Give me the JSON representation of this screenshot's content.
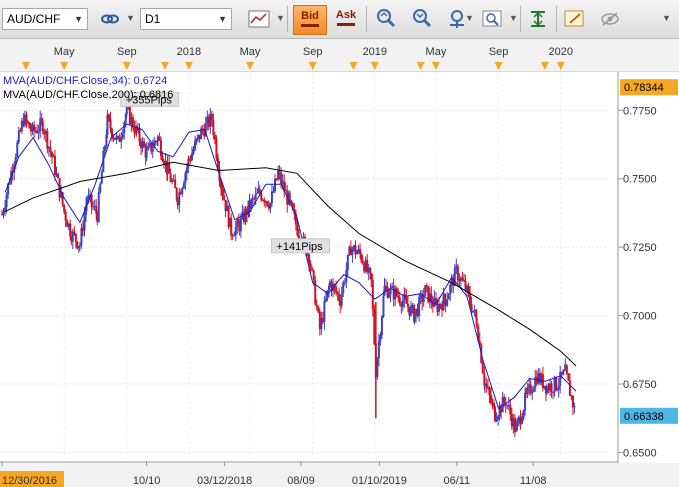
{
  "toolbar": {
    "symbol": "AUD/CHF",
    "timeframe": "D1",
    "bid_label": "Bid",
    "ask_label": "Ask"
  },
  "colors": {
    "up_candle": "#4040c0",
    "down_candle": "#d01020",
    "ma34": "#1a1ac8",
    "ma200": "#000000",
    "last_price_bg": "#4fb6e8",
    "high_price_bg": "#f5a623",
    "accent": "#f5a623"
  },
  "legend": {
    "ma34": "MVA(AUD/CHF.Close,34): 0.6724",
    "ma200": "MVA(AUD/CHF.Close,200): 0.6816"
  },
  "annotations": [
    {
      "text": "+355Pips",
      "date": "2017-08-28",
      "price": 0.779
    },
    {
      "text": "+141Pips",
      "date": "2018-06-20",
      "price": 0.7255
    }
  ],
  "top_axis_labels": [
    "May",
    "Sep",
    "2018",
    "May",
    "Sep",
    "2019",
    "May",
    "Sep",
    "2020"
  ],
  "bottom_axis_labels": [
    "12/30/2016",
    "10/10",
    "03/12/2018",
    "08/09",
    "01/10/2019",
    "06/11",
    "11/08"
  ],
  "price_ticks": [
    "0.7750",
    "0.7500",
    "0.7250",
    "0.7000",
    "0.6750",
    "0.6500"
  ],
  "price_labels": {
    "high": "0.78344",
    "last": "0.66338"
  },
  "chart_data": {
    "type": "line",
    "title": "",
    "series_type": "candlestick",
    "x_range": [
      "2016-12-30",
      "2020-01-31"
    ],
    "ylim": [
      0.645,
      0.786
    ],
    "series": [
      {
        "name": "MVA(AUD/CHF.Close,34)",
        "style": "line",
        "points": [
          [
            "2017-01-05",
            0.745
          ],
          [
            "2017-02-01",
            0.758
          ],
          [
            "2017-03-01",
            0.765
          ],
          [
            "2017-04-01",
            0.755
          ],
          [
            "2017-05-01",
            0.743
          ],
          [
            "2017-06-01",
            0.734
          ],
          [
            "2017-07-01",
            0.748
          ],
          [
            "2017-08-01",
            0.765
          ],
          [
            "2017-09-01",
            0.77
          ],
          [
            "2017-10-01",
            0.768
          ],
          [
            "2017-11-01",
            0.76
          ],
          [
            "2017-12-01",
            0.758
          ],
          [
            "2018-01-01",
            0.767
          ],
          [
            "2018-02-01",
            0.768
          ],
          [
            "2018-03-01",
            0.752
          ],
          [
            "2018-04-01",
            0.735
          ],
          [
            "2018-05-01",
            0.738
          ],
          [
            "2018-06-01",
            0.748
          ],
          [
            "2018-07-01",
            0.748
          ],
          [
            "2018-08-01",
            0.736
          ],
          [
            "2018-09-01",
            0.712
          ],
          [
            "2018-10-01",
            0.708
          ],
          [
            "2018-11-01",
            0.715
          ],
          [
            "2018-12-01",
            0.712
          ],
          [
            "2019-01-01",
            0.706
          ],
          [
            "2019-02-01",
            0.71
          ],
          [
            "2019-03-01",
            0.707
          ],
          [
            "2019-04-01",
            0.708
          ],
          [
            "2019-05-01",
            0.704
          ],
          [
            "2019-06-01",
            0.714
          ],
          [
            "2019-07-01",
            0.707
          ],
          [
            "2019-08-01",
            0.684
          ],
          [
            "2019-09-01",
            0.666
          ],
          [
            "2019-10-01",
            0.67
          ],
          [
            "2019-11-01",
            0.677
          ],
          [
            "2019-12-01",
            0.676
          ],
          [
            "2020-01-01",
            0.678
          ],
          [
            "2020-01-31",
            0.6724
          ]
        ]
      },
      {
        "name": "MVA(AUD/CHF.Close,200)",
        "style": "line",
        "points": [
          [
            "2017-01-05",
            0.738
          ],
          [
            "2017-03-01",
            0.743
          ],
          [
            "2017-06-01",
            0.749
          ],
          [
            "2017-09-01",
            0.752
          ],
          [
            "2017-12-01",
            0.756
          ],
          [
            "2018-03-01",
            0.753
          ],
          [
            "2018-06-01",
            0.754
          ],
          [
            "2018-08-01",
            0.752
          ],
          [
            "2018-10-01",
            0.74
          ],
          [
            "2018-12-01",
            0.73
          ],
          [
            "2019-03-01",
            0.72
          ],
          [
            "2019-06-01",
            0.712
          ],
          [
            "2019-09-01",
            0.702
          ],
          [
            "2019-11-01",
            0.695
          ],
          [
            "2020-01-01",
            0.687
          ],
          [
            "2020-01-31",
            0.6816
          ]
        ]
      },
      {
        "name": "AUD/CHF",
        "style": "close",
        "points": [
          [
            "2016-12-30",
            0.737
          ],
          [
            "2017-01-20",
            0.755
          ],
          [
            "2017-02-10",
            0.772
          ],
          [
            "2017-02-28",
            0.767
          ],
          [
            "2017-03-20",
            0.77
          ],
          [
            "2017-04-10",
            0.756
          ],
          [
            "2017-05-01",
            0.738
          ],
          [
            "2017-05-15",
            0.73
          ],
          [
            "2017-06-01",
            0.726
          ],
          [
            "2017-06-15",
            0.743
          ],
          [
            "2017-07-05",
            0.737
          ],
          [
            "2017-07-25",
            0.771
          ],
          [
            "2017-08-15",
            0.763
          ],
          [
            "2017-09-01",
            0.775
          ],
          [
            "2017-09-20",
            0.767
          ],
          [
            "2017-10-10",
            0.759
          ],
          [
            "2017-11-01",
            0.765
          ],
          [
            "2017-11-20",
            0.753
          ],
          [
            "2017-12-10",
            0.743
          ],
          [
            "2018-01-01",
            0.757
          ],
          [
            "2018-01-25",
            0.767
          ],
          [
            "2018-02-15",
            0.772
          ],
          [
            "2018-03-05",
            0.748
          ],
          [
            "2018-03-25",
            0.731
          ],
          [
            "2018-04-10",
            0.733
          ],
          [
            "2018-04-30",
            0.74
          ],
          [
            "2018-05-20",
            0.745
          ],
          [
            "2018-06-10",
            0.741
          ],
          [
            "2018-06-25",
            0.752
          ],
          [
            "2018-07-15",
            0.742
          ],
          [
            "2018-08-05",
            0.73
          ],
          [
            "2018-08-25",
            0.722
          ],
          [
            "2018-09-15",
            0.695
          ],
          [
            "2018-10-05",
            0.712
          ],
          [
            "2018-10-25",
            0.706
          ],
          [
            "2018-11-15",
            0.725
          ],
          [
            "2018-12-05",
            0.722
          ],
          [
            "2018-12-25",
            0.712
          ],
          [
            "2019-01-03",
            0.68
          ],
          [
            "2019-01-20",
            0.71
          ],
          [
            "2019-02-10",
            0.708
          ],
          [
            "2019-03-01",
            0.705
          ],
          [
            "2019-03-20",
            0.7
          ],
          [
            "2019-04-10",
            0.709
          ],
          [
            "2019-05-01",
            0.703
          ],
          [
            "2019-05-20",
            0.706
          ],
          [
            "2019-06-10",
            0.716
          ],
          [
            "2019-06-28",
            0.71
          ],
          [
            "2019-07-20",
            0.698
          ],
          [
            "2019-08-05",
            0.675
          ],
          [
            "2019-08-25",
            0.664
          ],
          [
            "2019-09-15",
            0.669
          ],
          [
            "2019-10-05",
            0.658
          ],
          [
            "2019-10-25",
            0.67
          ],
          [
            "2019-11-15",
            0.678
          ],
          [
            "2019-12-05",
            0.674
          ],
          [
            "2019-12-25",
            0.675
          ],
          [
            "2020-01-10",
            0.679
          ],
          [
            "2020-01-31",
            0.66338
          ]
        ]
      }
    ]
  }
}
